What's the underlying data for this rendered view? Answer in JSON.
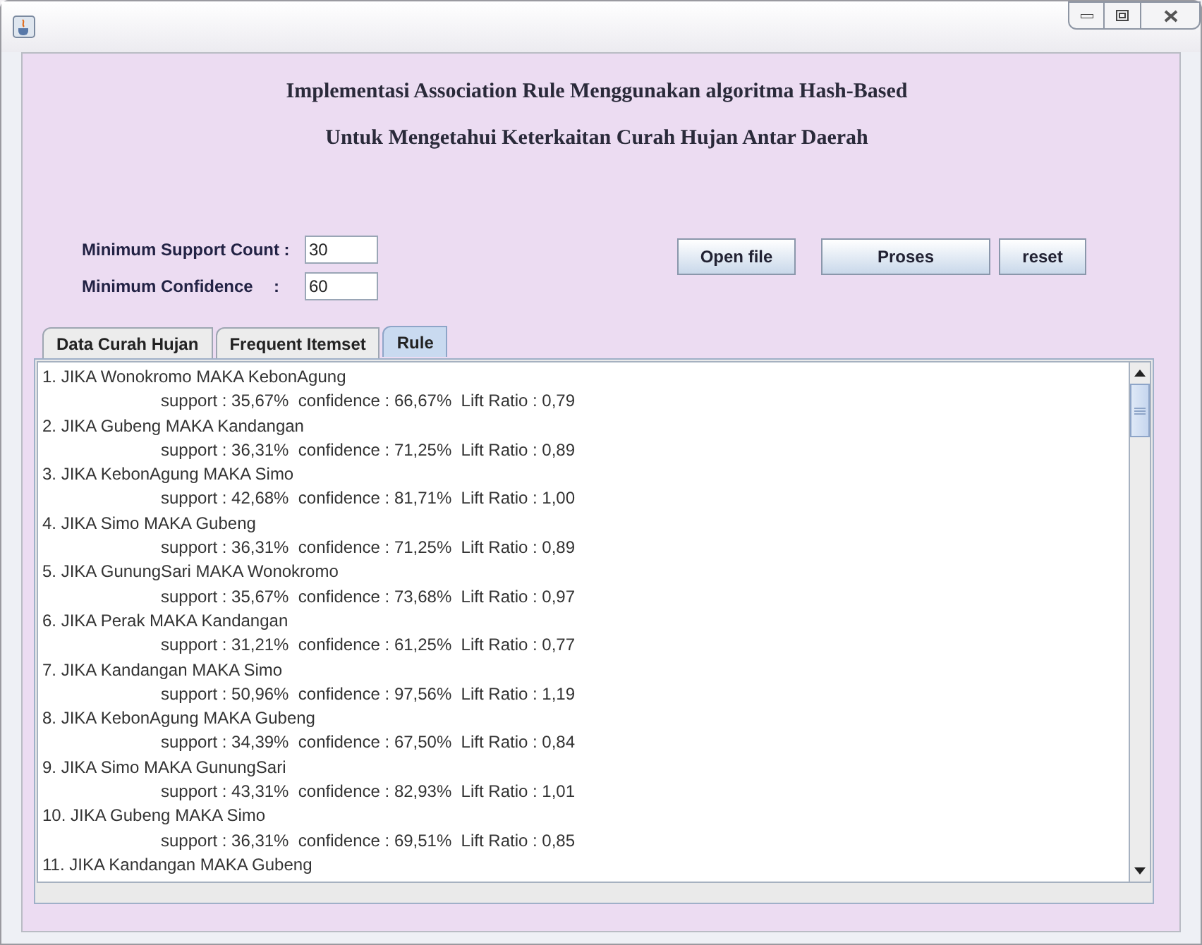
{
  "window": {
    "title_lines": [
      "Implementasi Association Rule Menggunakan algoritma Hash-Based",
      "Untuk Mengetahui Keterkaitan Curah Hujan Antar Daerah"
    ]
  },
  "fields": [
    {
      "label": "Minimum Support Count :",
      "value": "30"
    },
    {
      "label": "Minimum Confidence",
      "separator": ":",
      "value": "60"
    }
  ],
  "buttons": [
    "Open file",
    "Proses",
    "reset"
  ],
  "tabs": [
    {
      "label": "Data Curah Hujan",
      "selected": false
    },
    {
      "label": "Frequent Itemset",
      "selected": false
    },
    {
      "label": "Rule",
      "selected": true
    }
  ],
  "rules": [
    {
      "rule": "1. JIKA Wonokromo MAKA KebonAgung",
      "detail": "support : 35,67%  confidence : 66,67%  Lift Ratio : 0,79"
    },
    {
      "rule": "2. JIKA Gubeng MAKA Kandangan",
      "detail": "support : 36,31%  confidence : 71,25%  Lift Ratio : 0,89"
    },
    {
      "rule": "3. JIKA KebonAgung MAKA Simo",
      "detail": "support : 42,68%  confidence : 81,71%  Lift Ratio : 1,00"
    },
    {
      "rule": "4. JIKA Simo MAKA Gubeng",
      "detail": "support : 36,31%  confidence : 71,25%  Lift Ratio : 0,89"
    },
    {
      "rule": "5. JIKA GunungSari MAKA Wonokromo",
      "detail": "support : 35,67%  confidence : 73,68%  Lift Ratio : 0,97"
    },
    {
      "rule": "6. JIKA Perak MAKA Kandangan",
      "detail": "support : 31,21%  confidence : 61,25%  Lift Ratio : 0,77"
    },
    {
      "rule": "7. JIKA Kandangan MAKA Simo",
      "detail": "support : 50,96%  confidence : 97,56%  Lift Ratio : 1,19"
    },
    {
      "rule": "8. JIKA KebonAgung MAKA Gubeng",
      "detail": "support : 34,39%  confidence : 67,50%  Lift Ratio : 0,84"
    },
    {
      "rule": "9. JIKA Simo MAKA GunungSari",
      "detail": "support : 43,31%  confidence : 82,93%  Lift Ratio : 1,01"
    },
    {
      "rule": "10. JIKA Gubeng MAKA Simo",
      "detail": "support : 36,31%  confidence : 69,51%  Lift Ratio : 0,85"
    },
    {
      "rule": "11. JIKA Kandangan MAKA Gubeng"
    }
  ]
}
